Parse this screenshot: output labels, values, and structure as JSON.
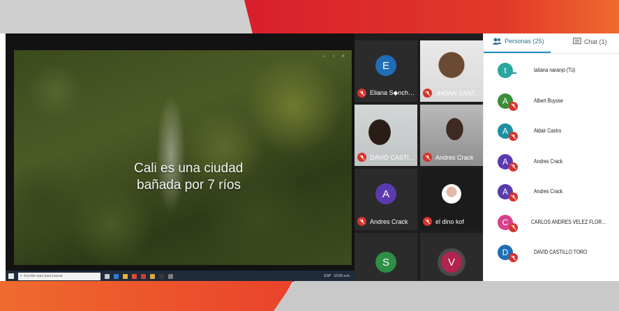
{
  "share": {
    "caption_line1": "Cali es una ciudad",
    "caption_line2": "bañada por 7 ríos",
    "window_controls": [
      "–",
      "▫",
      "×"
    ],
    "taskbar": {
      "search_placeholder": "Escribe aquí para buscar",
      "tray_text": "ESP",
      "time": "10:00 a.m."
    }
  },
  "gallery": {
    "tiles": [
      {
        "name": "Eliana S◆nch…",
        "initial": "E",
        "color": "#1f6db5",
        "kind": "avatar"
      },
      {
        "name": "JHOAN SANT…",
        "kind": "video"
      },
      {
        "name": "DAVID CASTI…",
        "kind": "video"
      },
      {
        "name": "Andres Crack",
        "kind": "video"
      },
      {
        "name": "Andres Crack",
        "initial": "A",
        "color": "#5b3ab0",
        "kind": "avatar"
      },
      {
        "name": "el dino kof",
        "kind": "photo"
      },
      {
        "name": "",
        "initial": "S",
        "color": "#2f8f47",
        "kind": "avatar"
      },
      {
        "name": "",
        "initial": "V",
        "color": "#b2234e",
        "kind": "avatar"
      }
    ]
  },
  "panel": {
    "tabs": {
      "people_label": "Personas (25)",
      "chat_label": "Chat (1)"
    },
    "participants": [
      {
        "initial": "t",
        "name": "tatiana naranjo (Tú)",
        "color": "#2aa6a0",
        "muted": false
      },
      {
        "initial": "A",
        "name": "Albert Buysse",
        "color": "#3b8e3a",
        "muted": true
      },
      {
        "initial": "A",
        "name": "Aldair Castro",
        "color": "#1f8fa2",
        "muted": true
      },
      {
        "initial": "A",
        "name": "Andres Crack",
        "color": "#5b3ab0",
        "muted": true
      },
      {
        "initial": "A",
        "name": "Andres Crack",
        "color": "#5b3ab0",
        "muted": true
      },
      {
        "initial": "C",
        "name": "CARLOS ANDRES VELEZ FLOR…",
        "color": "#d6428b",
        "muted": true
      },
      {
        "initial": "D",
        "name": "DAVID CASTILLO TORO",
        "color": "#1f6db5",
        "muted": true
      }
    ]
  },
  "colors": {
    "accent_red": "#d81f2c",
    "accent_orange": "#ef6a2e",
    "tab_blue": "#1e8fc0",
    "mute_red": "#d5342c"
  }
}
